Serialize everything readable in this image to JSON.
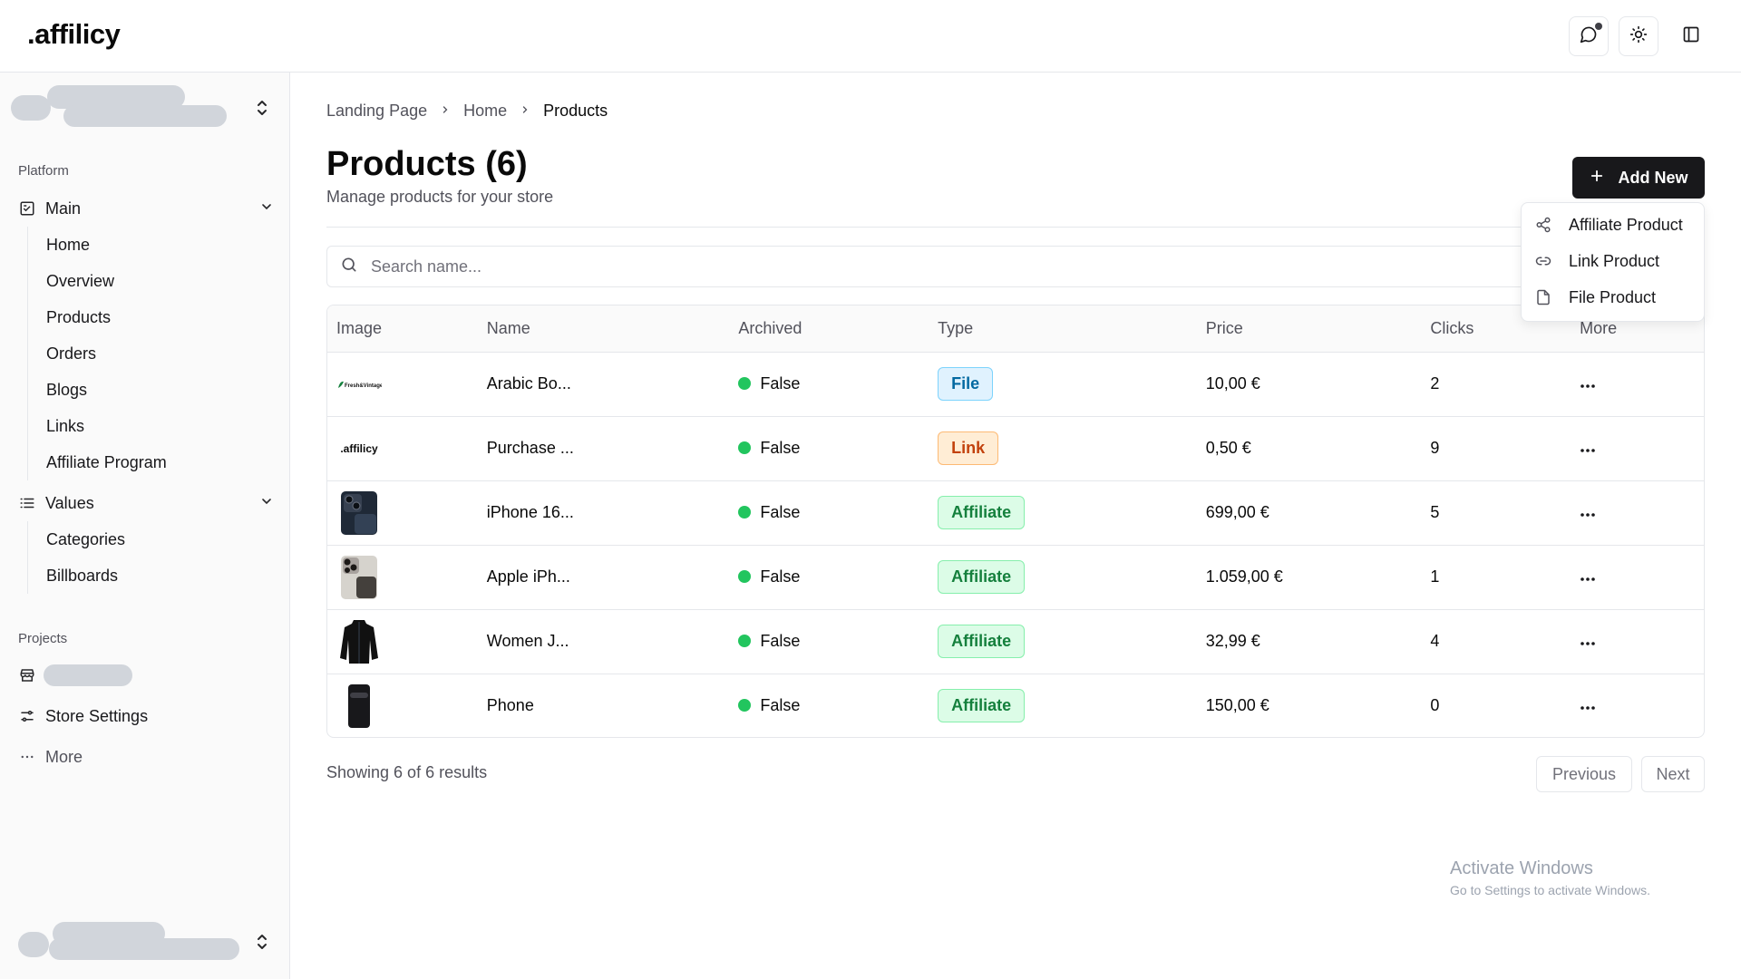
{
  "app": {
    "logo": ".affilicy"
  },
  "header": {
    "chat_icon": "message-circle-icon",
    "theme_icon": "sun-icon",
    "panel_icon": "panel-left-icon"
  },
  "sidebar": {
    "groups": {
      "platform": "Platform",
      "projects": "Projects"
    },
    "main": {
      "label": "Main",
      "items": [
        "Home",
        "Overview",
        "Products",
        "Orders",
        "Blogs",
        "Links",
        "Affiliate Program"
      ]
    },
    "values": {
      "label": "Values",
      "items": [
        "Categories",
        "Billboards"
      ]
    },
    "store_settings": "Store Settings",
    "more": "More"
  },
  "breadcrumb": [
    "Landing Page",
    "Home",
    "Products"
  ],
  "page": {
    "title": "Products (6)",
    "subtitle": "Manage products for your store",
    "add_new": "Add New"
  },
  "search": {
    "placeholder": "Search name..."
  },
  "table": {
    "columns": [
      "Image",
      "Name",
      "Archived",
      "Type",
      "Price",
      "Clicks",
      "More"
    ],
    "rows": [
      {
        "image": "fresh-vintage-logo",
        "name": "Arabic Bo...",
        "archived": "False",
        "type": "File",
        "price": "10,00 €",
        "clicks": "2"
      },
      {
        "image": "affilicy-logo",
        "name": "Purchase ...",
        "archived": "False",
        "type": "Link",
        "price": "0,50 €",
        "clicks": "9"
      },
      {
        "image": "iphone-image",
        "name": "iPhone 16...",
        "archived": "False",
        "type": "Affiliate",
        "price": "699,00 €",
        "clicks": "5"
      },
      {
        "image": "iphone-image",
        "name": "Apple iPh...",
        "archived": "False",
        "type": "Affiliate",
        "price": "1.059,00 €",
        "clicks": "1"
      },
      {
        "image": "jacket-image",
        "name": "Women J...",
        "archived": "False",
        "type": "Affiliate",
        "price": "32,99 €",
        "clicks": "4"
      },
      {
        "image": "phone-image",
        "name": "Phone",
        "archived": "False",
        "type": "Affiliate",
        "price": "150,00 €",
        "clicks": "0"
      }
    ]
  },
  "footer": {
    "results": "Showing 6 of 6 results",
    "previous": "Previous",
    "next": "Next"
  },
  "dropdown": {
    "items": [
      {
        "label": "Affiliate Product",
        "icon": "share-icon"
      },
      {
        "label": "Link Product",
        "icon": "link-icon"
      },
      {
        "label": "File Product",
        "icon": "file-icon"
      }
    ]
  },
  "watermark": {
    "line1": "Activate Windows",
    "line2": "Go to Settings to activate Windows."
  },
  "colors": {
    "accent": "#18181b",
    "archived_dot": "#22c55e",
    "file_badge": "#0369a1",
    "link_badge": "#c2410c",
    "affiliate_badge": "#15803d"
  }
}
